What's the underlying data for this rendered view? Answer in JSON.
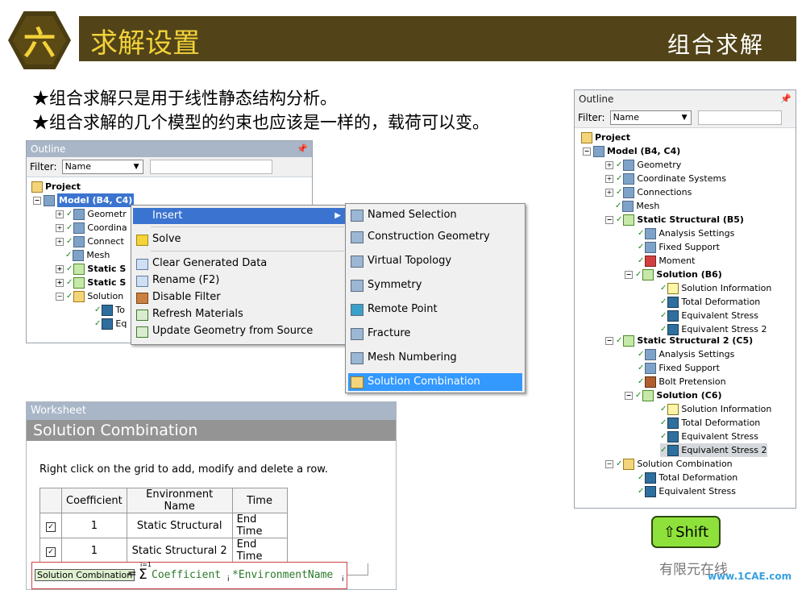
{
  "header": {
    "number": "六",
    "title": "求解设置",
    "subtitle": "组合求解"
  },
  "bullets": [
    "★组合求解只是用于线性静态结构分析。",
    "★组合求解的几个模型的约束也应该是一样的，载荷可以变。"
  ],
  "outline_left": {
    "title": "Outline",
    "filter_label": "Filter:",
    "filter_value": "Name",
    "project": "Project",
    "model": "Model (B4, C4)",
    "items": [
      "Geometr",
      "Coordina",
      "Connect",
      "Mesh",
      "Static S",
      "Static S",
      "Solution",
      "To",
      "Eq"
    ]
  },
  "context_menu": {
    "items": [
      "Insert",
      "Solve",
      "Clear Generated Data",
      "Rename (F2)",
      "Disable Filter",
      "Refresh Materials",
      "Update Geometry from Source"
    ]
  },
  "insert_submenu": {
    "items": [
      "Named Selection",
      "Construction Geometry",
      "Virtual Topology",
      "Symmetry",
      "Remote Point",
      "Fracture",
      "Mesh Numbering",
      "Solution Combination"
    ]
  },
  "worksheet": {
    "panel_title": "Worksheet",
    "title": "Solution Combination",
    "instruction": "Right click on the grid to add, modify and delete a row.",
    "columns": [
      "Coefficient",
      "Environment Name",
      "Time"
    ],
    "rows": [
      {
        "coefficient": "1",
        "env": "Static Structural",
        "time": "End Time",
        "checked": true
      },
      {
        "coefficient": "1",
        "env": "Static Structural 2",
        "time": "End Time",
        "checked": true
      }
    ],
    "formula_label": "Solution Combination",
    "formula_eq": "=",
    "formula_sum_top": "i=1",
    "formula_sigma": "Σ",
    "formula_text": "Coefficient",
    "formula_sub1": "i",
    "formula_mid": "*EnvironmentName",
    "formula_sub2": "i"
  },
  "outline_right": {
    "title": "Outline",
    "filter_label": "Filter:",
    "filter_value": "Name",
    "project": "Project",
    "model": "Model (B4, C4)",
    "geometry": "Geometry",
    "coord": "Coordinate Systems",
    "connections": "Connections",
    "mesh": "Mesh",
    "ss1": "Static Structural (B5)",
    "ss1_children": [
      "Analysis Settings",
      "Fixed Support",
      "Moment"
    ],
    "sol1": "Solution (B6)",
    "sol1_children": [
      "Solution Information",
      "Total Deformation",
      "Equivalent Stress",
      "Equivalent Stress 2"
    ],
    "ss2": "Static Structural 2 (C5)",
    "ss2_children": [
      "Analysis Settings",
      "Fixed Support",
      "Bolt Pretension"
    ],
    "sol2": "Solution (C6)",
    "sol2_children": [
      "Solution Information",
      "Total Deformation",
      "Equivalent Stress",
      "Equivalent Stress 2"
    ],
    "combo": "Solution Combination",
    "combo_children": [
      "Total Deformation",
      "Equivalent Stress"
    ]
  },
  "shift_button": "⇧Shift",
  "watermark": {
    "text": "有限元在线",
    "site": "www.1CAE.com"
  }
}
